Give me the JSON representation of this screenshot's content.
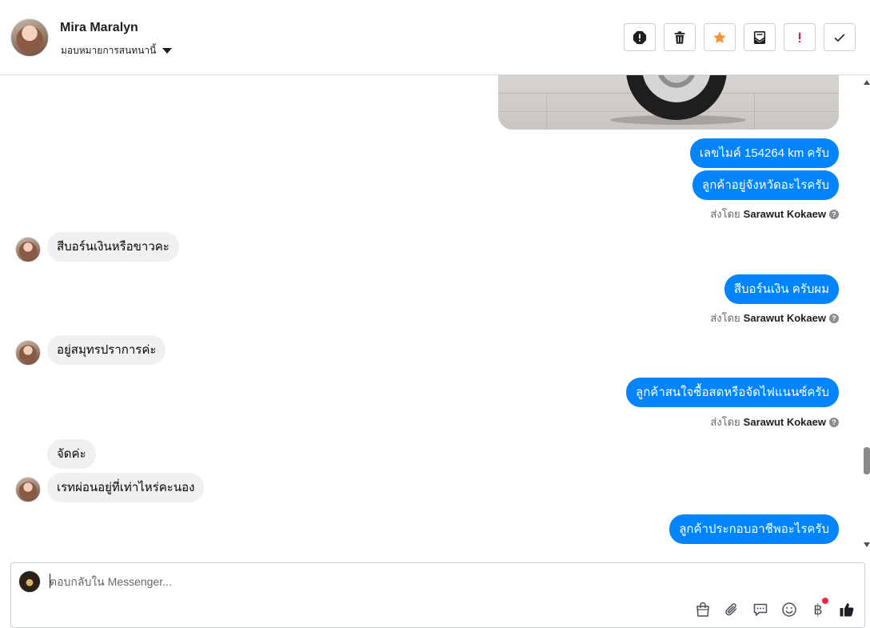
{
  "header": {
    "contact_name": "Mira Maralyn",
    "assign_label": "มอบหมายการสนทนานี้",
    "toolbar": [
      {
        "name": "report-spam-icon",
        "label": "Report"
      },
      {
        "name": "trash-icon",
        "label": "Delete"
      },
      {
        "name": "star-icon",
        "label": "Star",
        "color": "#f7923a"
      },
      {
        "name": "archive-icon",
        "label": "Archive"
      },
      {
        "name": "important-icon",
        "label": "Important",
        "color": "#e41e3f"
      },
      {
        "name": "check-icon",
        "label": "Done"
      }
    ]
  },
  "messages": {
    "out1": "เลขไมค์ 154264 km ครับ",
    "out2": "ลูกค้าอยู่จังหวัดอะไรครับ",
    "in1": "สีบอร์นเงินหรือขาวคะ",
    "out3": "สีบอร์นเงิน ครับผม",
    "in2": "อยู่สมุทรปราการค่ะ",
    "out4": "ลูกค้าสนใจซื้อสดหรือจัดไฟแนนซ์ครับ",
    "in3": "จัดค่ะ",
    "in4": "เรทผ่อนอยู่ที่เท่าไหร่คะนอง",
    "out5": "ลูกค้าประกอบอาชีพอะไรครับ"
  },
  "sent_by": {
    "prefix": "ส่งโดย",
    "sender": "Sarawut Kokaew",
    "help": "?"
  },
  "composer": {
    "placeholder": "ตอบกลับใน Messenger...",
    "tools": [
      "shopping-bag-icon",
      "paperclip-icon",
      "saved-reply-icon",
      "emoji-icon",
      "baht-icon",
      "thumbs-up-icon"
    ],
    "baht_symbol": "฿"
  },
  "colors": {
    "outgoing_bubble": "#0084ff",
    "incoming_bubble": "#f0f0f0"
  }
}
